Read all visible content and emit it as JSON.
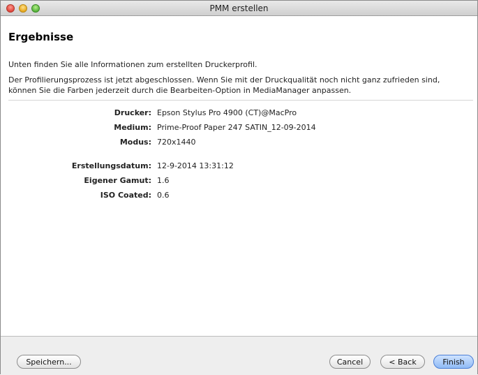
{
  "window": {
    "title": "PMM erstellen"
  },
  "header": {
    "title": "Ergebnisse"
  },
  "intro": {
    "line1": "Unten finden Sie alle Informationen zum erstellten Druckerprofil.",
    "line2": "Der Profilierungsprozess ist jetzt abgeschlossen. Wenn Sie mit der Druckqualität noch nicht ganz zufrieden sind, können Sie die Farben jederzeit durch die Bearbeiten-Option in MediaManager anpassen."
  },
  "details": {
    "printer": {
      "label": "Drucker:",
      "value": "Epson Stylus Pro 4900 (CT)@MacPro"
    },
    "medium": {
      "label": "Medium:",
      "value": "Prime-Proof Paper 247 SATIN_12-09-2014"
    },
    "mode": {
      "label": "Modus:",
      "value": "720x1440"
    },
    "created": {
      "label": "Erstellungsdatum:",
      "value": "12-9-2014 13:31:12"
    },
    "gamut": {
      "label": "Eigener Gamut:",
      "value": "1.6"
    },
    "iso": {
      "label": "ISO Coated:",
      "value": "0.6"
    }
  },
  "buttons": {
    "save": "Speichern...",
    "cancel": "Cancel",
    "back": "< Back",
    "finish": "Finish"
  }
}
